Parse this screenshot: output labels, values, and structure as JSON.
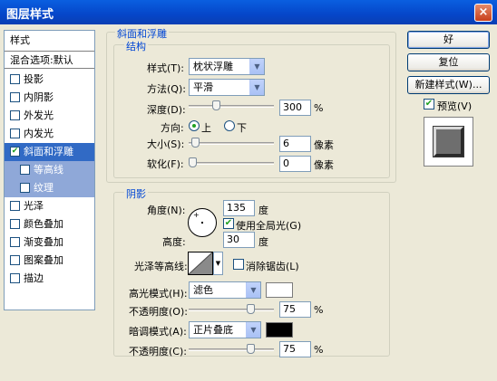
{
  "window": {
    "title": "图层样式",
    "close_icon": "close-icon"
  },
  "styles_list": {
    "header": "样式",
    "blend_options": "混合选项:默认",
    "items": [
      {
        "label": "投影",
        "checked": false
      },
      {
        "label": "内阴影",
        "checked": false
      },
      {
        "label": "外发光",
        "checked": false
      },
      {
        "label": "内发光",
        "checked": false
      },
      {
        "label": "斜面和浮雕",
        "checked": true
      },
      {
        "label": "等高线",
        "checked": false
      },
      {
        "label": "纹理",
        "checked": false
      },
      {
        "label": "光泽",
        "checked": false
      },
      {
        "label": "颜色叠加",
        "checked": false
      },
      {
        "label": "渐变叠加",
        "checked": false
      },
      {
        "label": "图案叠加",
        "checked": false
      },
      {
        "label": "描边",
        "checked": false
      }
    ]
  },
  "bevel": {
    "group_title": "斜面和浮雕",
    "structure_title": "结构",
    "style_label": "样式(T):",
    "style_value": "枕状浮雕",
    "technique_label": "方法(Q):",
    "technique_value": "平滑",
    "depth_label": "深度(D):",
    "depth_value": "300",
    "depth_unit": "%",
    "depth_slider": 0.3,
    "direction_label": "方向:",
    "direction_up": "上",
    "direction_down": "下",
    "direction_selected": "up",
    "size_label": "大小(S):",
    "size_value": "6",
    "size_unit": "像素",
    "size_slider": 0.04,
    "soften_label": "软化(F):",
    "soften_value": "0",
    "soften_unit": "像素",
    "soften_slider": 0.0
  },
  "shading": {
    "title": "阴影",
    "angle_label": "角度(N):",
    "angle_value": "135",
    "angle_unit": "度",
    "global_light_label": "使用全局光(G)",
    "global_light_checked": true,
    "altitude_label": "高度:",
    "altitude_value": "30",
    "altitude_unit": "度",
    "gloss_contour_label": "光泽等高线:",
    "antialias_label": "消除锯齿(L)",
    "antialias_checked": false,
    "highlight_mode_label": "高光模式(H):",
    "highlight_mode_value": "滤色",
    "highlight_color": "#ffffff",
    "highlight_opacity_label": "不透明度(O):",
    "highlight_opacity_value": "75",
    "highlight_opacity_unit": "%",
    "highlight_opacity_slider": 0.75,
    "shadow_mode_label": "暗调模式(A):",
    "shadow_mode_value": "正片叠底",
    "shadow_color": "#000000",
    "shadow_opacity_label": "不透明度(C):",
    "shadow_opacity_value": "75",
    "shadow_opacity_unit": "%",
    "shadow_opacity_slider": 0.75
  },
  "buttons": {
    "ok": "好",
    "reset": "复位",
    "new_style": "新建样式(W)...",
    "preview_label": "预览(V)",
    "preview_checked": true
  }
}
